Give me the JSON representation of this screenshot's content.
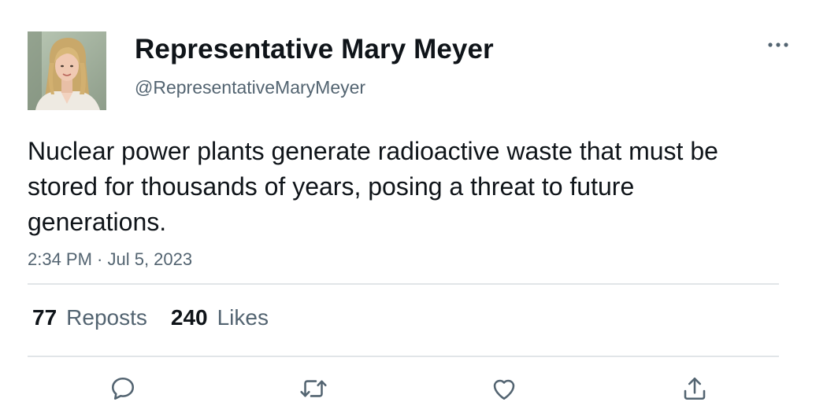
{
  "author": {
    "display_name": "Representative Mary Meyer",
    "handle": "@RepresentativeMaryMeyer",
    "avatar_icon": "profile-photo"
  },
  "tweet": {
    "text": "Nuclear power plants generate radioactive waste that must be stored for thousands of years, posing a threat to future generations.",
    "timestamp": "2:34 PM · Jul 5, 2023"
  },
  "stats": {
    "reposts_count": "77",
    "reposts_label": "Reposts",
    "likes_count": "240",
    "likes_label": "Likes"
  },
  "actions": {
    "reply_icon": "comment-icon",
    "repost_icon": "repost-icon",
    "like_icon": "heart-icon",
    "share_icon": "share-icon",
    "more_icon": "more-options-icon"
  },
  "colors": {
    "text_primary": "#0f1419",
    "text_secondary": "#536471",
    "divider": "#e1e5e8"
  }
}
